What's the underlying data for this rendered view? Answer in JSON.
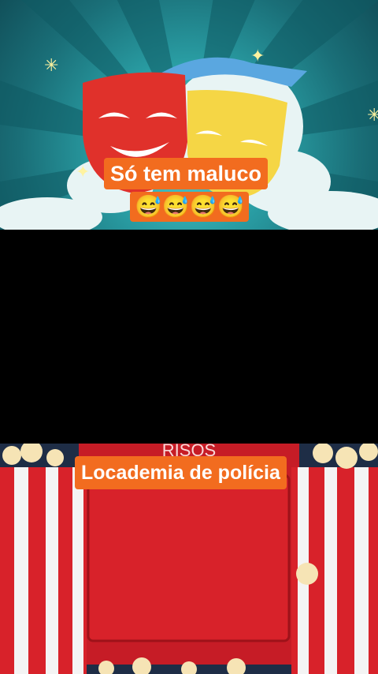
{
  "captions": {
    "top_line1": "Só tem maluco",
    "top_line2": "😅😅😅😅",
    "bottom": "Locademia de polícia"
  },
  "banner": {
    "partial_text": "RISOS"
  },
  "colors": {
    "caption_bg": "#f26c1f",
    "teal": "#2a9fa5",
    "red_mask": "#e0312b",
    "yellow_mask": "#f5d645",
    "popcorn_red": "#d8222a"
  },
  "icons": [
    "theatre-masks-icon",
    "sparkle-icon",
    "popcorn-icon"
  ]
}
